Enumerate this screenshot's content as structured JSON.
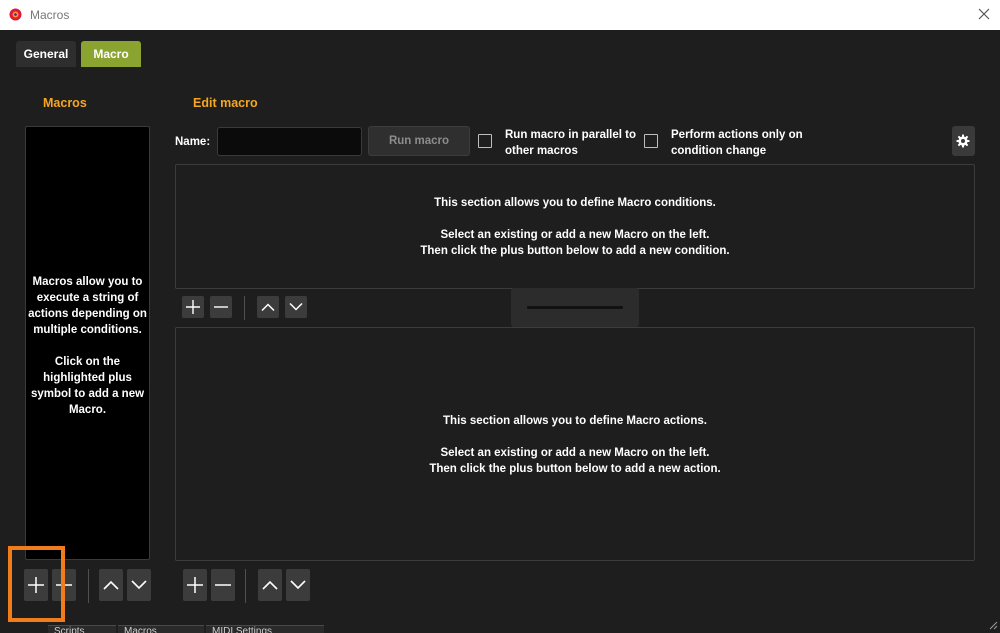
{
  "window": {
    "title": "Macros"
  },
  "tabs": [
    {
      "label": "General",
      "active": false
    },
    {
      "label": "Macro",
      "active": true
    }
  ],
  "macros_panel": {
    "title": "Macros",
    "help_text": "Macros allow you to\nexecute a string of\nactions depending on\nmultiple conditions.\n\nClick on the\nhighlighted plus\nsymbol to add a new\nMacro."
  },
  "edit_macro": {
    "title": "Edit macro",
    "name_label": "Name:",
    "name_value": "",
    "run_button": "Run macro",
    "parallel_checkbox": {
      "label": "Run macro in parallel to\nother macros",
      "checked": false
    },
    "change_checkbox": {
      "label": "Perform actions only on\ncondition change",
      "checked": false
    }
  },
  "conditions_section": {
    "text": "This section allows you to define Macro conditions.\n\nSelect an existing or add a new Macro on the left.\nThen click the plus button below to add a new condition."
  },
  "actions_section": {
    "text": "This section allows you to define Macro actions.\n\nSelect an existing or add a new Macro on the left.\nThen click the plus button below to add a new action."
  },
  "bottom_tabs": [
    "Scripts",
    "Macros",
    "MIDI Settings"
  ],
  "colors": {
    "accent_orange": "#f5a623",
    "active_tab": "#8ba32f",
    "highlight": "#f07c1b",
    "background": "#1e1e1e"
  },
  "icons": [
    "app-icon",
    "close-icon",
    "gear-icon",
    "plus-icon",
    "minus-icon",
    "up-arrow-icon",
    "down-arrow-icon"
  ]
}
